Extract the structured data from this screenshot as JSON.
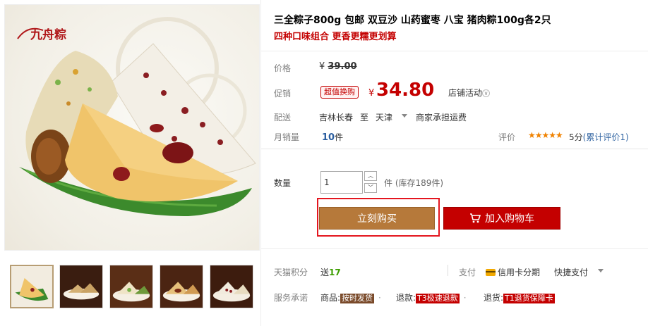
{
  "gallery": {
    "brand_logo_text": "九舟粽",
    "thumbnail_count": 5
  },
  "product": {
    "title": "三全粽子800g 包邮 双豆沙 山药蜜枣 八宝 猪肉粽100g各2只",
    "subtitle": "四种口味组合 更香更糯更划算"
  },
  "price": {
    "label": "价格",
    "currency": "¥",
    "original": "39.00"
  },
  "promo": {
    "label": "促销",
    "tag": "超值换购",
    "currency": "¥",
    "price": "34.80",
    "shop_activity": "店铺活动",
    "shop_activity_chevron": "∨"
  },
  "shipping": {
    "label": "配送",
    "from": "吉林长春",
    "to_word": "至",
    "destination": "天津",
    "fee": "商家承担运费"
  },
  "monthly": {
    "label": "月销量",
    "count": "10",
    "unit": "件"
  },
  "rating": {
    "label": "评价",
    "stars": "★★★★★",
    "score": "5分",
    "count_text": "(累计评价1)"
  },
  "quantity": {
    "label": "数量",
    "value": "1",
    "unit_stock": "件 (库存189件)",
    "up": "︿",
    "down": "﹀"
  },
  "actions": {
    "buy_now": "立刻购买",
    "add_to_cart": "加入购物车"
  },
  "points": {
    "label": "天猫积分",
    "prefix": "送",
    "value": "17"
  },
  "payment": {
    "label": "支付",
    "credit": "信用卡分期",
    "quick": "快捷支付"
  },
  "service": {
    "label": "服务承诺",
    "items": [
      {
        "prefix": "商品:",
        "tag": "按时发货"
      },
      {
        "prefix": "退款:",
        "tag": "T3极速退款"
      },
      {
        "prefix": "退货:",
        "tag": "T1退货保障卡"
      }
    ]
  },
  "colors": {
    "accent_red": "#c40000",
    "buy_brown": "#b6793a",
    "highlight_outline": "#e4161f",
    "star_orange": "#f08200"
  }
}
